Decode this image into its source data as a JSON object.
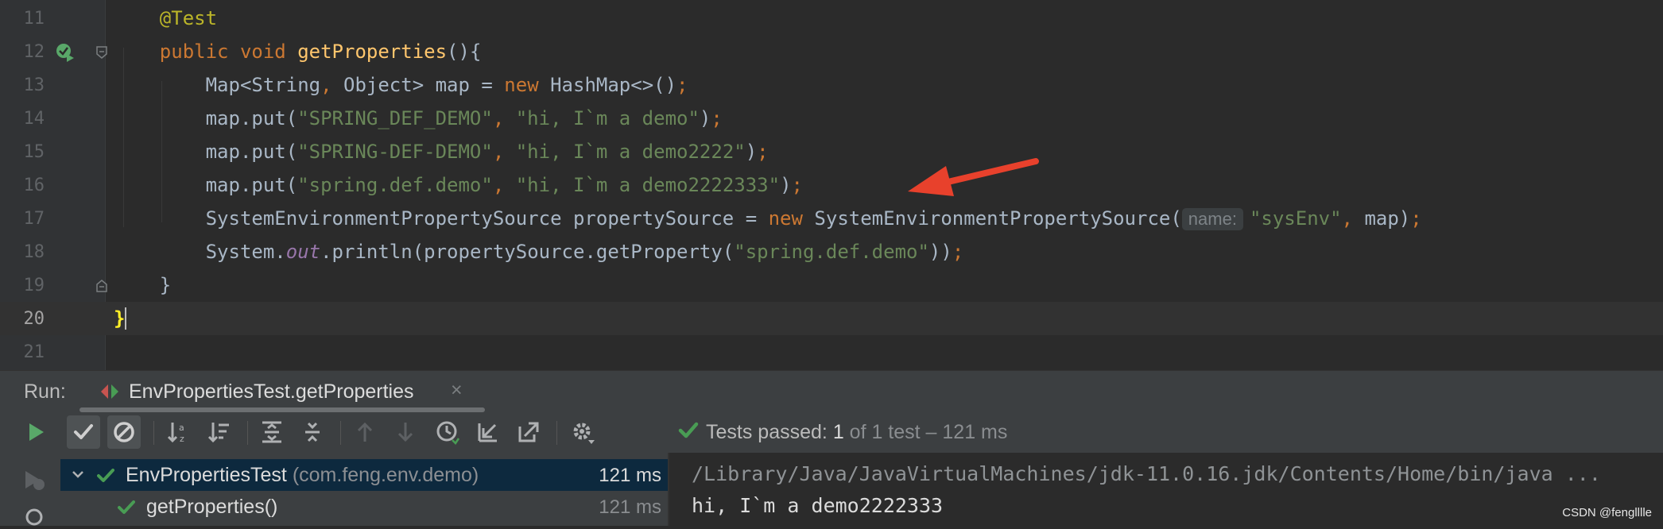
{
  "editor": {
    "lines": [
      {
        "number": "11",
        "code": [
          {
            "t": "    "
          },
          {
            "t": "@Test",
            "c": "ann"
          }
        ]
      },
      {
        "number": "12",
        "code": [
          {
            "t": "    "
          },
          {
            "t": "public",
            "c": "kw"
          },
          {
            "t": " "
          },
          {
            "t": "void",
            "c": "kw"
          },
          {
            "t": " "
          },
          {
            "t": "getProperties",
            "c": "fn"
          },
          {
            "t": "(){"
          }
        ]
      },
      {
        "number": "13",
        "code": [
          {
            "t": "        Map<String"
          },
          {
            "t": ",",
            "c": "kw"
          },
          {
            "t": " Object> map = "
          },
          {
            "t": "new",
            "c": "kw"
          },
          {
            "t": " HashMap<>()"
          },
          {
            "t": ";",
            "c": "kw"
          }
        ]
      },
      {
        "number": "14",
        "code": [
          {
            "t": "        map.put("
          },
          {
            "t": "\"SPRING_DEF_DEMO\"",
            "c": "str"
          },
          {
            "t": ", ",
            "c": "kw"
          },
          {
            "t": "\"hi, I`m a demo\"",
            "c": "str"
          },
          {
            "t": ")"
          },
          {
            "t": ";",
            "c": "kw"
          }
        ]
      },
      {
        "number": "15",
        "code": [
          {
            "t": "        map.put("
          },
          {
            "t": "\"SPRING-DEF-DEMO\"",
            "c": "str"
          },
          {
            "t": ", ",
            "c": "kw"
          },
          {
            "t": "\"hi, I`m a demo2222\"",
            "c": "str"
          },
          {
            "t": ")"
          },
          {
            "t": ";",
            "c": "kw"
          }
        ]
      },
      {
        "number": "16",
        "code": [
          {
            "t": "        map.put("
          },
          {
            "t": "\"spring.def.demo\"",
            "c": "str"
          },
          {
            "t": ", ",
            "c": "kw"
          },
          {
            "t": "\"hi, I`m a demo2222333\"",
            "c": "str"
          },
          {
            "t": ")"
          },
          {
            "t": ";",
            "c": "kw"
          }
        ]
      },
      {
        "number": "17",
        "code": [
          {
            "t": "        SystemEnvironmentPropertySource propertySource = "
          },
          {
            "t": "new",
            "c": "kw"
          },
          {
            "t": " SystemEnvironmentPropertySource("
          },
          {
            "t": "name:",
            "c": "hint"
          },
          {
            "t": "\"sysEnv\"",
            "c": "str"
          },
          {
            "t": ", ",
            "c": "kw"
          },
          {
            "t": "map)"
          },
          {
            "t": ";",
            "c": "kw"
          }
        ]
      },
      {
        "number": "18",
        "code": [
          {
            "t": "        System."
          },
          {
            "t": "out",
            "c": "fld"
          },
          {
            "t": ".println(propertySource.getProperty("
          },
          {
            "t": "\"spring.def.demo\"",
            "c": "str"
          },
          {
            "t": "))"
          },
          {
            "t": ";",
            "c": "kw"
          }
        ]
      },
      {
        "number": "19",
        "code": [
          {
            "t": "    }"
          }
        ]
      },
      {
        "number": "20",
        "code": [
          {
            "t": "}",
            "c": "brace-hl"
          },
          {
            "t": "",
            "c": "caret"
          }
        ]
      },
      {
        "number": "21",
        "code": []
      }
    ],
    "current_line": "20"
  },
  "run_panel": {
    "label": "Run:",
    "tab_title": "EnvPropertiesTest.getProperties",
    "tab_close": "×",
    "status": {
      "prefix": "Tests passed: ",
      "count": "1",
      "detail": " of 1 test – 121 ms"
    },
    "tree": [
      {
        "label": "EnvPropertiesTest",
        "package": " (com.feng.env.demo)",
        "time": "121 ms",
        "selected": true
      },
      {
        "label": "getProperties()",
        "package": "",
        "time": "121 ms",
        "selected": false
      }
    ],
    "console": {
      "command": "/Library/Java/JavaVirtualMachines/jdk-11.0.16.jdk/Contents/Home/bin/java ...",
      "output": "hi, I`m a demo2222333"
    }
  },
  "watermark": "CSDN @fenglllle",
  "colors": {
    "editor_bg": "#2b2b2b",
    "keyword": "#cc7832",
    "string": "#6a8759",
    "method": "#ffc66d",
    "annotation": "#bbb529",
    "pass_green": "#499c54",
    "arrow_red": "#e8412c"
  }
}
